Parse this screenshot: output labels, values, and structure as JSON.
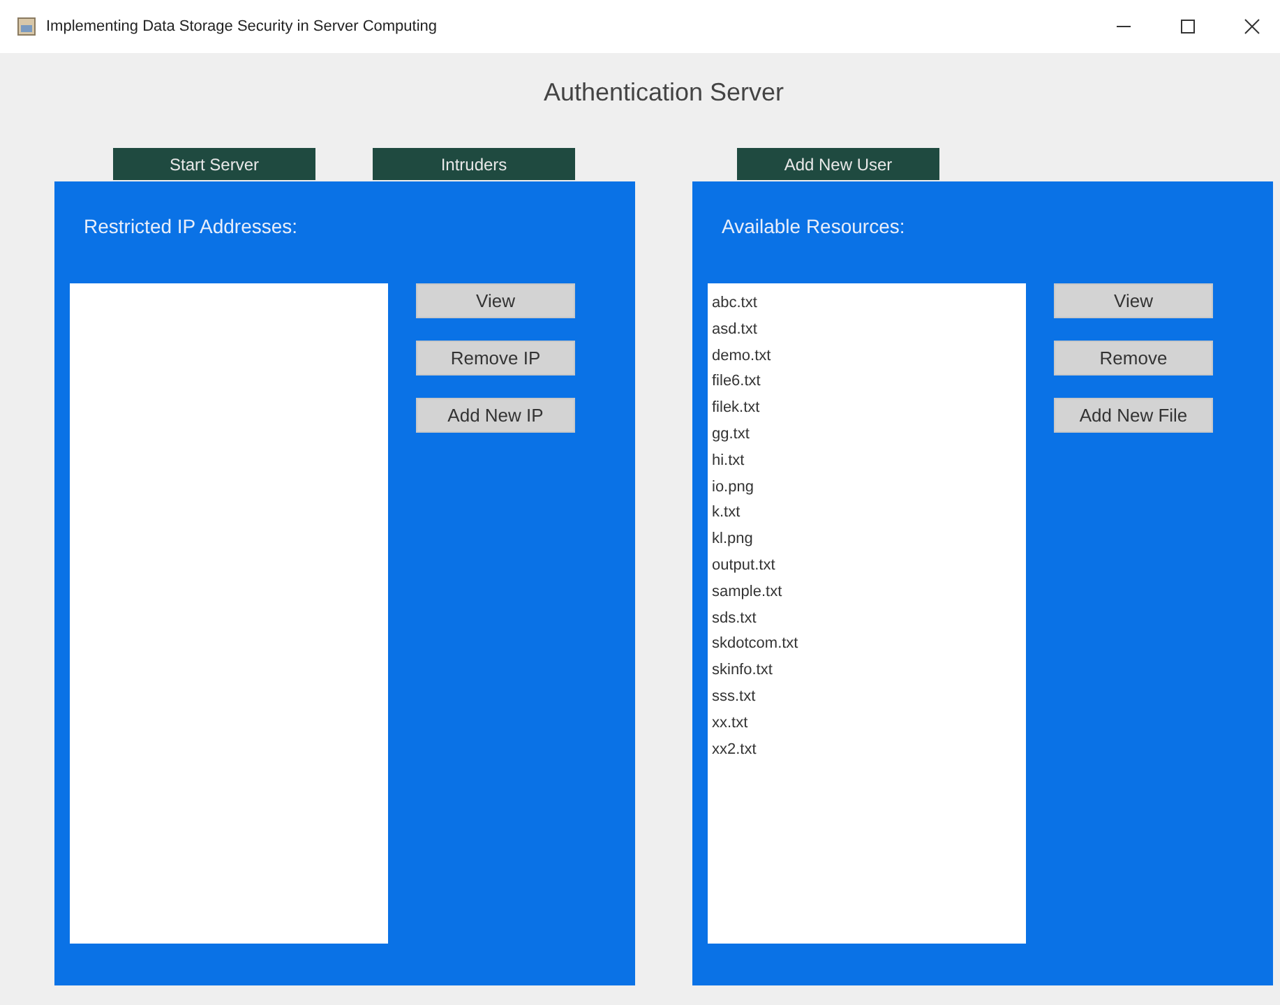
{
  "window": {
    "title": "Implementing Data Storage Security in Server Computing"
  },
  "heading": "Authentication Server",
  "panels": [
    {
      "tabs": [
        "Start Server",
        "Intruders"
      ],
      "label": "Restricted IP Addresses:",
      "buttons": [
        "View",
        "Remove IP",
        "Add New IP"
      ]
    },
    {
      "tabs": [
        "Add New User"
      ],
      "label": "Available Resources:",
      "items": [
        "abc.txt",
        "asd.txt",
        "demo.txt",
        "file6.txt",
        "filek.txt",
        "gg.txt",
        "hi.txt",
        "io.png",
        "k.txt",
        "kl.png",
        "output.txt",
        "sample.txt",
        "sds.txt",
        "skdotcom.txt",
        "skinfo.txt",
        "sss.txt",
        "xx.txt",
        "xx2.txt"
      ],
      "buttons": [
        "View",
        "Remove",
        "Add New File"
      ]
    }
  ]
}
